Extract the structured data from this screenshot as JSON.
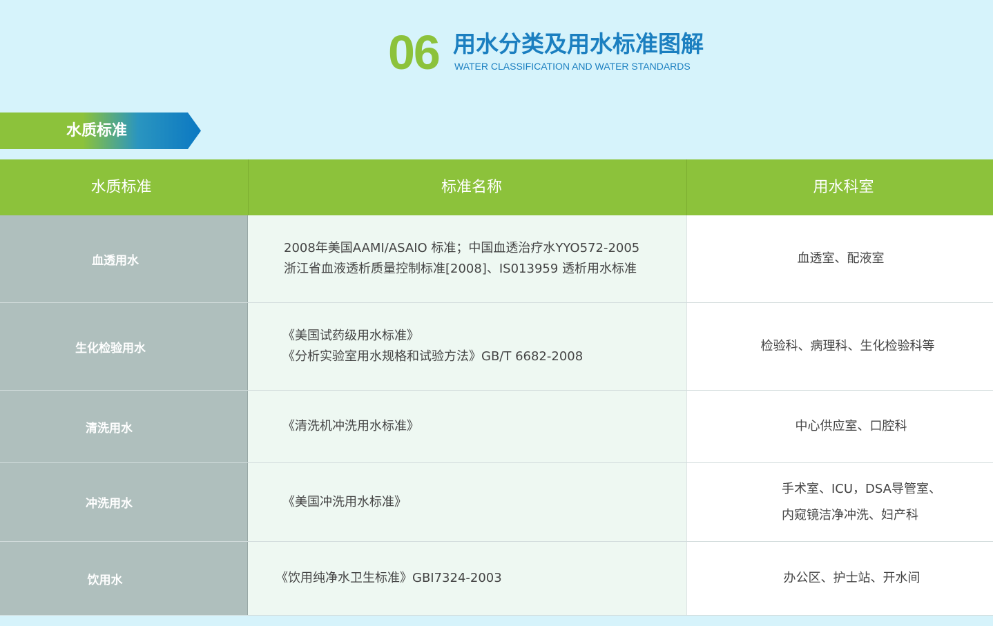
{
  "header": {
    "number": "06",
    "title_cn": "用水分类及用水标准图解",
    "title_en": "WATER CLASSIFICATION AND WATER STANDARDS"
  },
  "section": {
    "label": "水质标准"
  },
  "table": {
    "columns": [
      "水质标准",
      "标准名称",
      "用水科室"
    ],
    "rows": [
      {
        "quality": "血透用水",
        "standard_lines": [
          "2008年美国AAMI/ASAIO  标准；中国血透治疗水YYO572-2005",
          "浙江省血液透析质量控制标准[2008]、IS013959 透析用水标准"
        ],
        "departments": [
          "血透室、配液室"
        ]
      },
      {
        "quality": "生化检验用水",
        "standard_lines": [
          "《美国试药级用水标准》",
          "《分析实验室用水规格和试验方法》GB/T 6682-2008"
        ],
        "departments": [
          "检验科、病理科、生化检验科等"
        ]
      },
      {
        "quality": "清洗用水",
        "standard_lines": [
          "《清洗机冲洗用水标准》"
        ],
        "departments": [
          "中心供应室、口腔科"
        ]
      },
      {
        "quality": "冲洗用水",
        "standard_lines": [
          "《美国冲洗用水标准》"
        ],
        "departments": [
          "手术室、ICU，DSA导管室、",
          "内窥镜洁净冲洗、妇产科"
        ]
      },
      {
        "quality": "饮用水",
        "standard_lines": [
          "《饮用纯净水卫生标准》GBI7324-2003"
        ],
        "departments": [
          "办公区、护士站、开水间"
        ]
      }
    ]
  },
  "colors": {
    "background": "#d6f3fb",
    "green": "#8cc23b",
    "blue": "#1b7fc0",
    "gray_column": "#afbfbd",
    "light_green_column": "#eef8f2"
  }
}
